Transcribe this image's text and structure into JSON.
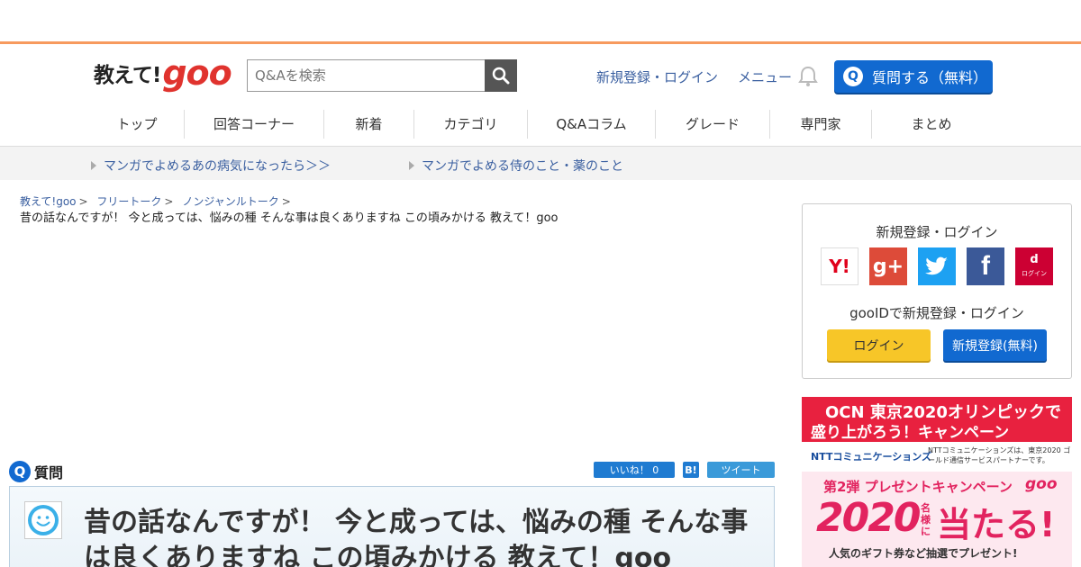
{
  "header": {
    "logo_text": "教えて!",
    "logo_brand": "goo",
    "search_placeholder": "Q&Aを検索",
    "link_login": "新規登録・ログイン",
    "link_menu": "メニュー",
    "ask_button": "質問する（無料）",
    "ask_icon_letter": "Q"
  },
  "gnav": [
    "トップ",
    "回答コーナー",
    "新着",
    "カテゴリ",
    "Q&Aコラム",
    "グレード",
    "専門家",
    "まとめ"
  ],
  "subbar": {
    "link1": "マンガでよめるあの病気になったら＞＞",
    "link2": "マンガでよめる侍のこと・薬のこと"
  },
  "breadcrumb": {
    "items": [
      "教えて!goo",
      "フリートーク",
      "ノンジャンルトーク"
    ],
    "separator": ">",
    "current": "昔の話なんですが！ 今と成っては、悩みの種 そんな事は良くありますね この頃みかける 教えて！goo"
  },
  "question": {
    "icon_letter": "Q",
    "label": "質問",
    "like_label": "いいね！ 0",
    "hatena_label": "B!",
    "tweet_label": "ツイート",
    "title": "昔の話なんですが！ 今と成っては、悩みの種 そんな事は良くありますね この頃みかける 教えて！goo"
  },
  "sidebar": {
    "heading": "新規登録・ログイン",
    "providers": [
      "Y!",
      "g+",
      "t",
      "f",
      "d"
    ],
    "docomo_label": "ログイン",
    "gooid_heading": "gooIDで新規登録・ログイン",
    "login_button": "ログイン",
    "register_button": "新規登録(無料)"
  },
  "ad1": {
    "line1": "OCN 東京2020オリンピックで",
    "line2": "盛り上がろう！キャンペーン",
    "brand": "NTTコミュニケーションズ",
    "note": "NTTコミュニケーションズは、東京2020 ゴールド通信サービスパートナーです。"
  },
  "ad2": {
    "line1": "第2弾 プレゼントキャンペーン",
    "brand": "goo",
    "big": "2020",
    "mid": "名様に",
    "hit": "当たる!",
    "bottom": "人気のギフト券など抽選でプレゼント!"
  },
  "colors": {
    "accent_orange": "#f79a5e",
    "brand_red": "#e0332e",
    "link_blue": "#3a5fa0",
    "button_blue": "#1169d0",
    "login_yellow": "#f7c628"
  }
}
